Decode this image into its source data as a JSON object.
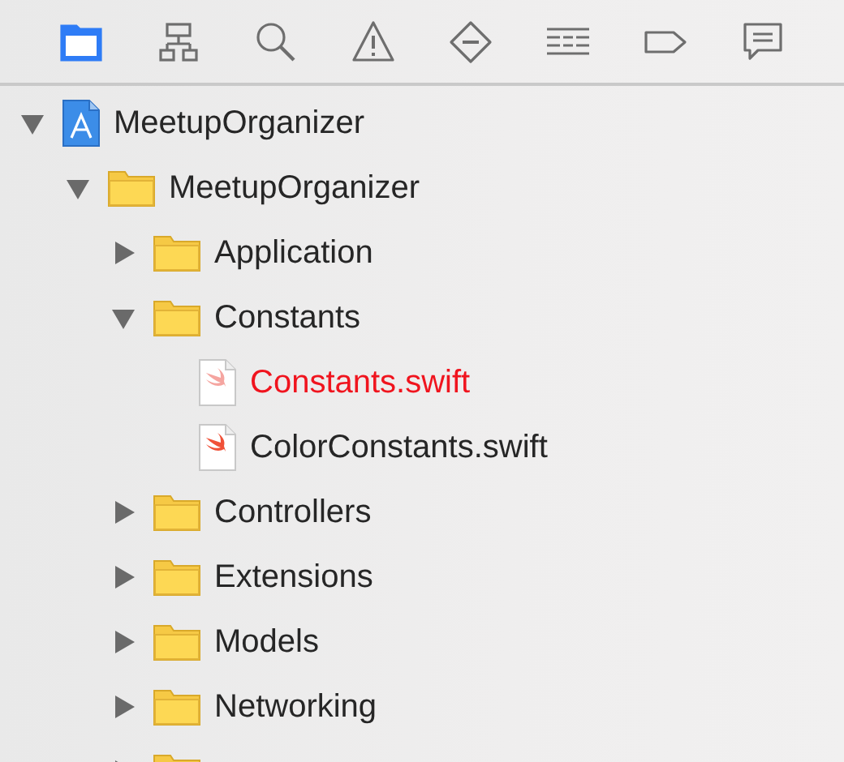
{
  "toolbar": [
    {
      "kind": "folder",
      "selected": true
    },
    {
      "kind": "hierarchy",
      "selected": false
    },
    {
      "kind": "search",
      "selected": false
    },
    {
      "kind": "warning",
      "selected": false
    },
    {
      "kind": "breakpoint",
      "selected": false
    },
    {
      "kind": "list",
      "selected": false
    },
    {
      "kind": "tag",
      "selected": false
    },
    {
      "kind": "message",
      "selected": false
    }
  ],
  "tree": [
    {
      "kind": "project",
      "label": "MeetupOrganizer",
      "expanded": true,
      "children": [
        {
          "kind": "folder",
          "label": "MeetupOrganizer",
          "expanded": true,
          "children": [
            {
              "kind": "folder",
              "label": "Application",
              "expanded": false
            },
            {
              "kind": "folder",
              "label": "Constants",
              "expanded": true,
              "children": [
                {
                  "kind": "swift",
                  "label": "Constants.swift",
                  "missing": true
                },
                {
                  "kind": "swift",
                  "label": "ColorConstants.swift",
                  "missing": false
                }
              ]
            },
            {
              "kind": "folder",
              "label": "Controllers",
              "expanded": false
            },
            {
              "kind": "folder",
              "label": "Extensions",
              "expanded": false
            },
            {
              "kind": "folder",
              "label": "Models",
              "expanded": false
            },
            {
              "kind": "folder",
              "label": "Networking",
              "expanded": false
            },
            {
              "kind": "folder",
              "expanded": false
            }
          ]
        }
      ]
    }
  ]
}
